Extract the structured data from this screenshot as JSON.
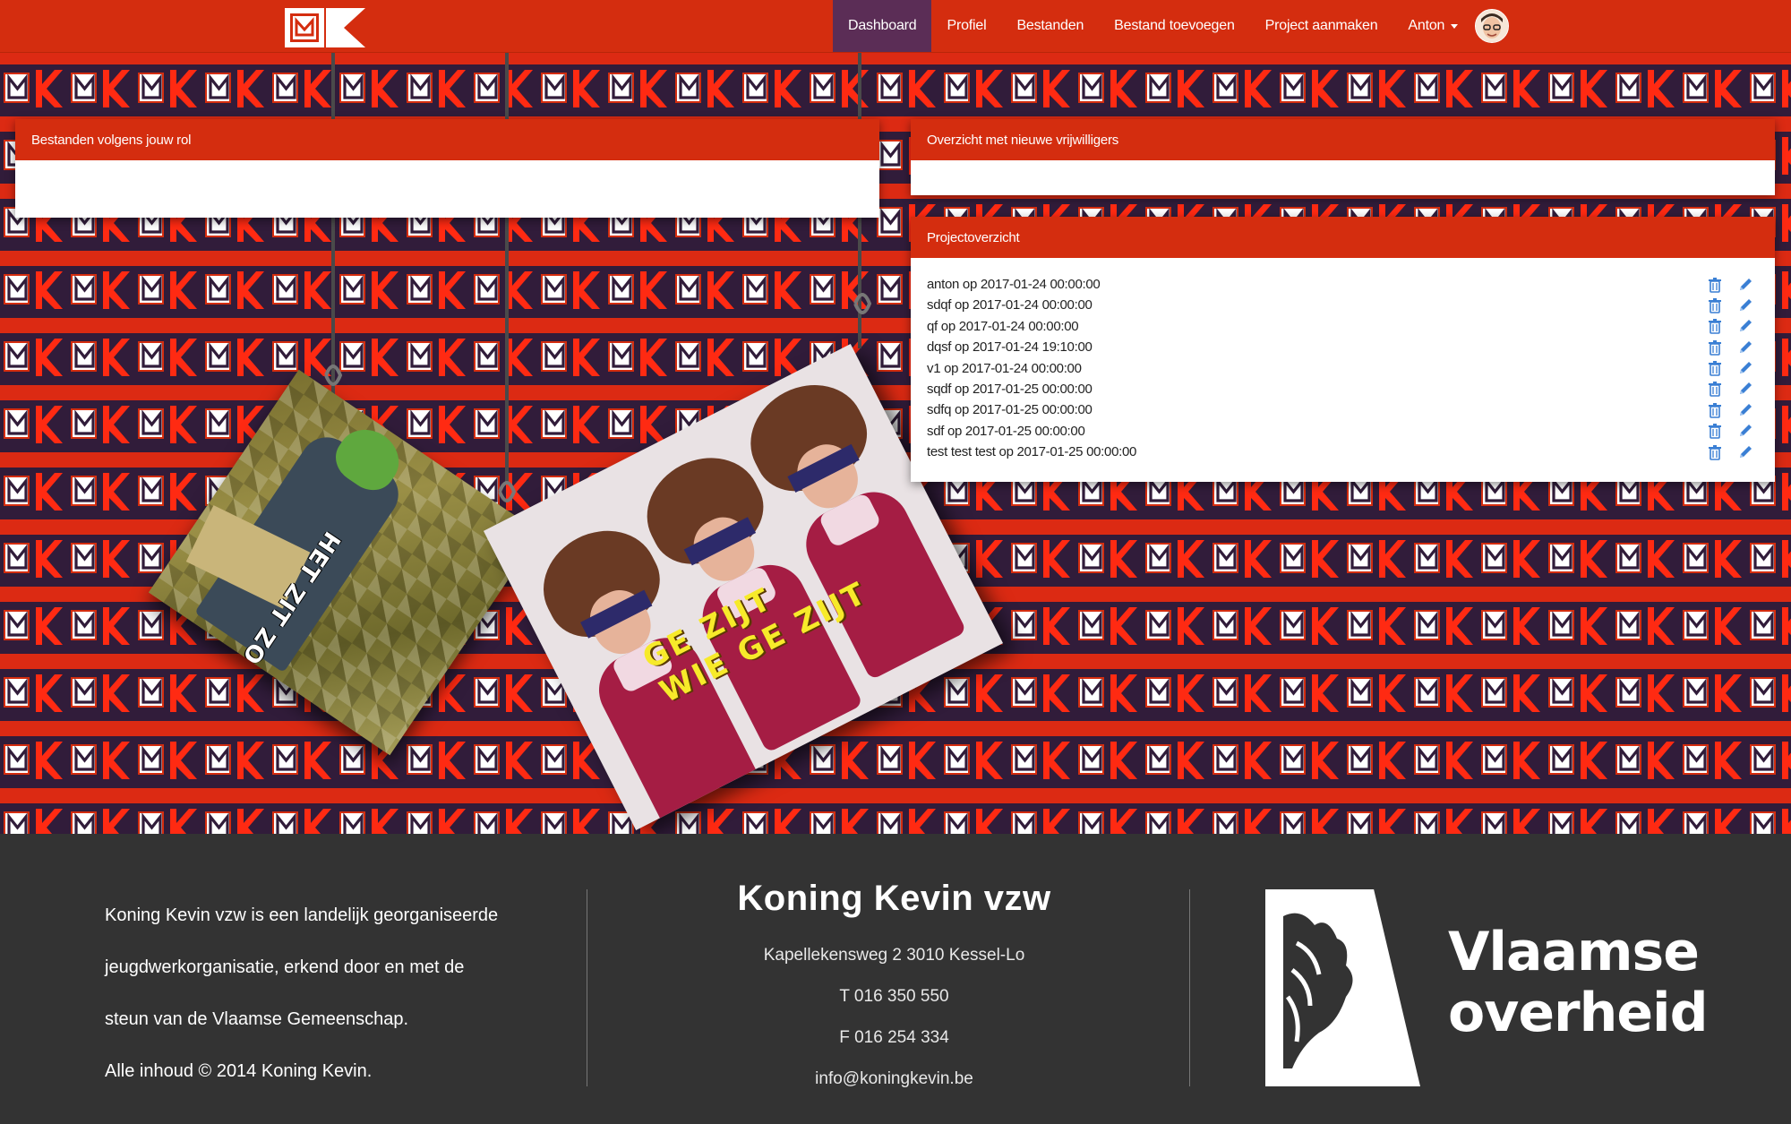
{
  "navbar": {
    "logo_name": "koning-kevin-logo",
    "items": [
      {
        "label": "Dashboard",
        "active": true
      },
      {
        "label": "Profiel"
      },
      {
        "label": "Bestanden"
      },
      {
        "label": "Bestand toevoegen"
      },
      {
        "label": "Project aanmaken"
      }
    ],
    "user": {
      "label": "Anton"
    }
  },
  "panels": {
    "files": {
      "title": "Bestanden volgens jouw rol"
    },
    "volunteers": {
      "title": "Overzicht met nieuwe vrijwilligers"
    },
    "projects": {
      "title": "Projectoverzicht",
      "items": [
        "anton op 2017-01-24 00:00:00",
        "sdqf op 2017-01-24 00:00:00",
        "qf op 2017-01-24 00:00:00",
        "dqsf op 2017-01-24 19:10:00",
        "v1 op 2017-01-24 00:00:00",
        "sqdf op 2017-01-25 00:00:00",
        "sdfq op 2017-01-25 00:00:00",
        "sdf op 2017-01-25 00:00:00",
        "test test test op 2017-01-25 00:00:00"
      ]
    }
  },
  "pictures": {
    "left_caption": "HET ZIT ZO",
    "right_caption_1": "GE ZIJT",
    "right_caption_2": "WIE GE ZIJT"
  },
  "footer": {
    "about": [
      "Koning Kevin vzw is een landelijk georganiseerde",
      "jeugdwerkorganisatie, erkend door en met de",
      "steun van de Vlaamse Gemeenschap.",
      "Alle inhoud © 2014 Koning Kevin."
    ],
    "org_name": "Koning Kevin vzw",
    "address": "Kapellekensweg 2 3010 Kessel-Lo",
    "phone": "T 016 350 550",
    "fax": "F 016 254 334",
    "email": "info@koningkevin.be",
    "gov_line1": "Vlaamse",
    "gov_line2": "overheid"
  },
  "colors": {
    "brand_red": "#d42d0f",
    "active_purple": "#5b2d56",
    "footer_bg": "#333333"
  }
}
